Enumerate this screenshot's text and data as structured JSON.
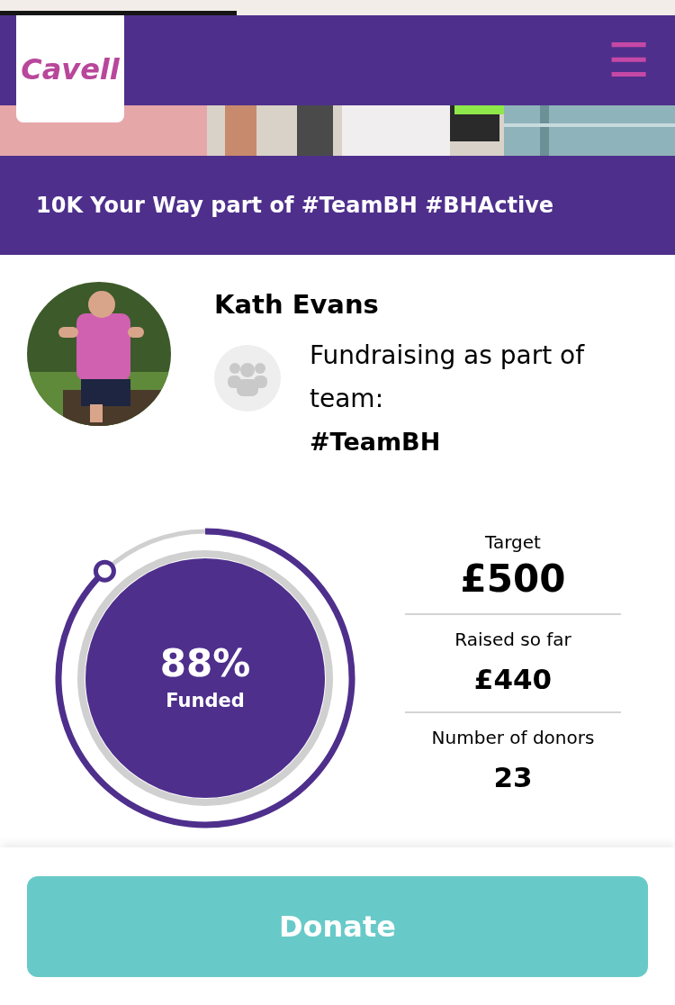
{
  "loading_bar": {
    "level": 0.35
  },
  "header": {
    "logo": "Cavell",
    "menu_icon": "☰"
  },
  "campaign_title": "10K Your Way part of #TeamBH #BHActive",
  "fundraiser": {
    "name": "Kath Evans",
    "team_text": "Fundraising as part of team:",
    "team_name": "#TeamBH"
  },
  "progress": {
    "percent": "88%",
    "caption": "Funded"
  },
  "stats": [
    {
      "label": "Target",
      "value": "£500",
      "emphasis": true
    },
    {
      "label": "Raised so far",
      "value": "£440",
      "emphasis": false
    },
    {
      "label": "Number of donors",
      "value": "23",
      "emphasis": false
    }
  ],
  "donate_button": "Donate"
}
